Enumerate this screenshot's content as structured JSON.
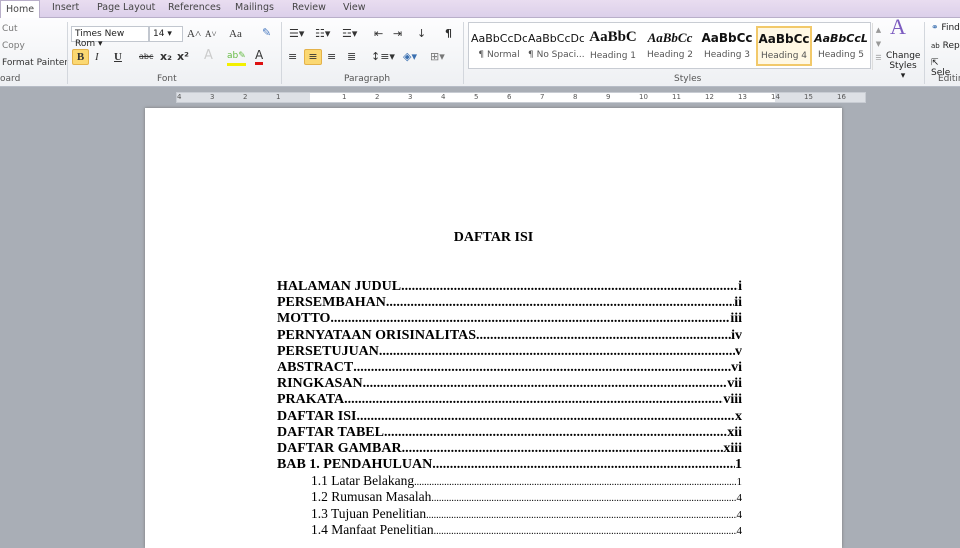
{
  "tabs": [
    "Home",
    "Insert",
    "Page Layout",
    "References",
    "Mailings",
    "Review",
    "View"
  ],
  "clipboard": {
    "cut": "Cut",
    "copy": "Copy",
    "format_painter": "Format Painter",
    "label": "oard"
  },
  "font": {
    "name": "Times New Rom",
    "size": "14",
    "label": "Font",
    "bold": "B",
    "italic": "I",
    "underline": "U",
    "strike": "abc",
    "sub": "x₂",
    "sup": "x²",
    "grow": "A˄",
    "shrink": "A˅",
    "case": "Aa"
  },
  "paragraph": {
    "label": "Paragraph"
  },
  "styles": {
    "label": "Styles",
    "items": [
      {
        "preview": "AaBbCcDc",
        "name": "¶ Normal"
      },
      {
        "preview": "AaBbCcDc",
        "name": "¶ No Spaci..."
      },
      {
        "preview": "AaBbC",
        "name": "Heading 1"
      },
      {
        "preview": "AaBbCc",
        "name": "Heading 2"
      },
      {
        "preview": "AaBbCc",
        "name": "Heading 3"
      },
      {
        "preview": "AaBbCc",
        "name": "Heading 4"
      },
      {
        "preview": "AaBbCcL",
        "name": "Heading 5"
      }
    ],
    "selected": "Heading 4",
    "change_line1": "Change",
    "change_line2": "Styles ▾"
  },
  "editing": {
    "find": "Find",
    "replace": "Rep",
    "select": "Sele",
    "label": "Editin"
  },
  "ruler": [
    "4",
    "3",
    "2",
    "1",
    "",
    "1",
    "2",
    "3",
    "4",
    "5",
    "6",
    "7",
    "8",
    "9",
    "10",
    "11",
    "12",
    "13",
    "14",
    "15",
    "16"
  ],
  "document": {
    "title": "DAFTAR ISI",
    "toc": [
      {
        "text": "HALAMAN JUDUL",
        "page": "i",
        "level": 1
      },
      {
        "text": "PERSEMBAHAN",
        "page": "ii",
        "level": 1
      },
      {
        "text": "MOTTO",
        "page": "iii",
        "level": 1
      },
      {
        "text": "PERNYATAAN ORISINALITAS",
        "page": "iv",
        "level": 1
      },
      {
        "text": "PERSETUJUAN",
        "page": "v",
        "level": 1
      },
      {
        "text": "ABSTRACT",
        "page": "vi",
        "level": 1
      },
      {
        "text": "RINGKASAN",
        "page": "vii",
        "level": 1
      },
      {
        "text": "PRAKATA",
        "page": "viii",
        "level": 1
      },
      {
        "text": "DAFTAR ISI",
        "page": "x",
        "level": 1
      },
      {
        "text": "DAFTAR TABEL",
        "page": "xii",
        "level": 1
      },
      {
        "text": "DAFTAR GAMBAR",
        "page": "xiii",
        "level": 1
      },
      {
        "text": "BAB 1. PENDAHULUAN",
        "page": "1",
        "level": 1
      },
      {
        "text": "1.1 Latar Belakang",
        "page": "1",
        "level": 2
      },
      {
        "text": "1.2 Rumusan Masalah",
        "page": "4",
        "level": 2
      },
      {
        "text": "1.3 Tujuan Penelitian",
        "page": "4",
        "level": 2
      },
      {
        "text": "1.4 Manfaat Penelitian",
        "page": "4",
        "level": 2
      }
    ]
  }
}
